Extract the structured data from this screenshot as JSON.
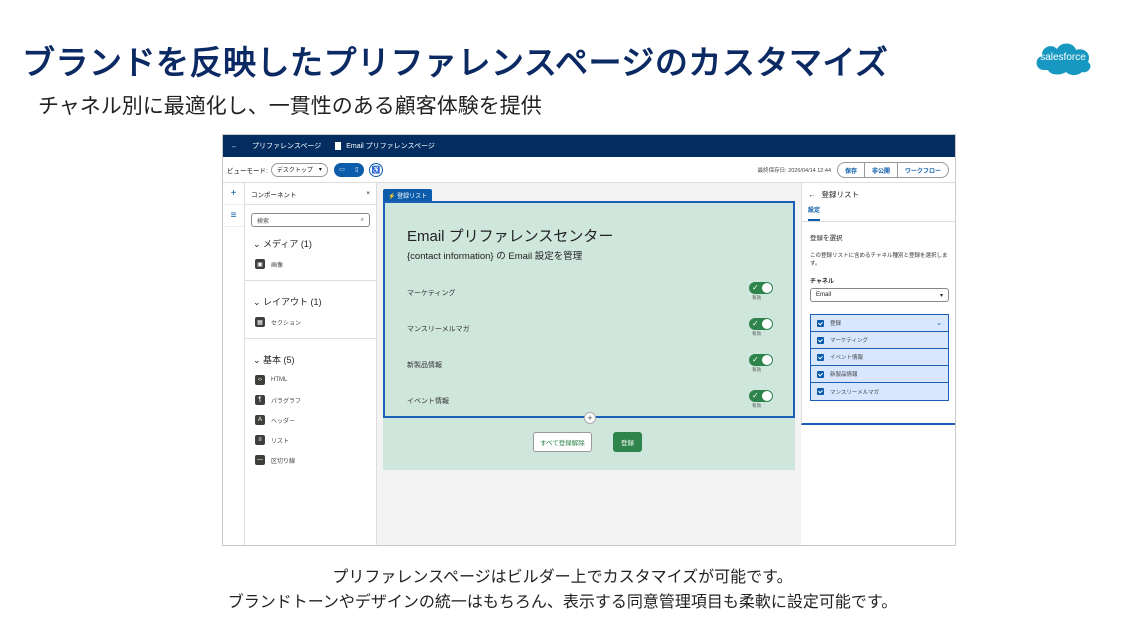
{
  "slide": {
    "title": "ブランドを反映したプリファレンスページのカスタマイズ",
    "subtitle": "チャネル別に最適化し、一貫性のある顧客体験を提供",
    "logo_text": "salesforce",
    "caption_line1": "プリファレンスページはビルダー上でカスタマイズが可能です。",
    "caption_line2": "ブランドトーンやデザインの統一はもちろん、表示する同意管理項目も柔軟に設定可能です。"
  },
  "topbar": {
    "back_icon": "←",
    "breadcrumb": "プリファレンスページ",
    "doc_title": "Email プリファレンスページ"
  },
  "toolbar": {
    "view_mode_label": "ビューモード:",
    "view_mode_value": "デスクトップ",
    "last_saved": "最終保存日: 2026/04/14 12:44",
    "save": "保存",
    "unpublish": "非公開",
    "workflow": "ワークフロー"
  },
  "left_panel": {
    "title": "コンポーネント",
    "close": "×",
    "search_placeholder": "検索",
    "sections": [
      {
        "title": "メディア (1)",
        "items": [
          {
            "icon": "▣",
            "label": "画像"
          }
        ]
      },
      {
        "title": "レイアウト (1)",
        "items": [
          {
            "icon": "▦",
            "label": "セクション"
          }
        ]
      },
      {
        "title": "基本 (5)",
        "items": [
          {
            "icon": "‹›",
            "label": "HTML"
          },
          {
            "icon": "¶",
            "label": "パラグラフ"
          },
          {
            "icon": "A",
            "label": "ヘッダー"
          },
          {
            "icon": "≡",
            "label": "リスト"
          },
          {
            "icon": "—",
            "label": "区切り線"
          }
        ]
      }
    ]
  },
  "canvas": {
    "component_tab": "登録リスト",
    "title": "Email プリファレンスセンター",
    "subtitle": "{contact information} の Email 設定を管理",
    "rows": [
      {
        "label": "マーケティング",
        "toggle_label": "有効",
        "enabled": true
      },
      {
        "label": "マンスリーメルマガ",
        "toggle_label": "有効",
        "enabled": true
      },
      {
        "label": "新製品情報",
        "toggle_label": "有効",
        "enabled": true
      },
      {
        "label": "イベント情報",
        "toggle_label": "有効",
        "enabled": true
      }
    ],
    "unsubscribe_all": "すべて登録解除",
    "subscribe": "登録"
  },
  "right_panel": {
    "title": "登録リスト",
    "tab": "設定",
    "select_label": "登録を選択",
    "description": "この登録リストに含めるチャネル種別と登録を選択します。",
    "channel_label": "チャネル",
    "channel_value": "Email",
    "list": [
      {
        "label": "登録",
        "header": true
      },
      {
        "label": "マーケティング"
      },
      {
        "label": "イベント情報"
      },
      {
        "label": "新製品情報"
      },
      {
        "label": "マンスリーメルマガ"
      }
    ]
  },
  "colors": {
    "title_navy": "#0b2a63",
    "brand_blue": "#0b5cab",
    "success_green": "#2e844a",
    "canvas_green": "#cfe6dc"
  }
}
